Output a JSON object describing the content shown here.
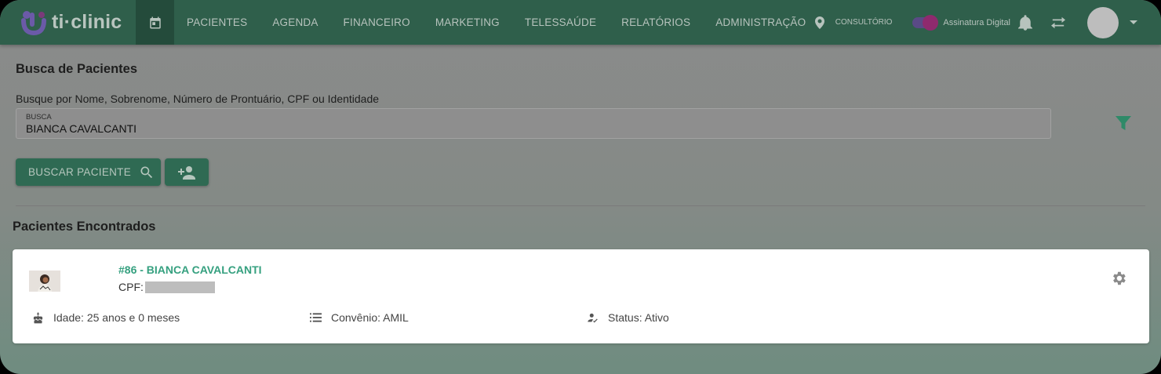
{
  "app": {
    "logo_text": "ti·clinic"
  },
  "nav": {
    "items": [
      "PACIENTES",
      "AGENDA",
      "FINANCEIRO",
      "MARKETING",
      "TELESSAÚDE",
      "RELATÓRIOS",
      "ADMINISTRAÇÃO"
    ],
    "location_label": "CONSULTÓRIO",
    "signature_label": "Assinatura Digital",
    "signature_enabled": true
  },
  "search": {
    "title": "Busca de Pacientes",
    "hint": "Busque por Nome, Sobrenome, Número de Prontuário, CPF ou Identidade",
    "field_label": "BUSCA",
    "field_value": "BIANCA CAVALCANTI",
    "search_button_label": "BUSCAR PACIENTE"
  },
  "results": {
    "title": "Pacientes Encontrados",
    "patients": [
      {
        "name": "#86 - BIANCA CAVALCANTI",
        "cpf_label": "CPF:",
        "age": "Idade: 25 anos e 0 meses",
        "insurance": "Convênio: AMIL",
        "status": "Status: Ativo"
      }
    ]
  },
  "colors": {
    "primary": "#2f5f4b",
    "accent": "#35a07f",
    "button": "#2f6a53"
  },
  "icons": {
    "calendar": "calendar-icon",
    "location": "location-pin-icon",
    "bell": "bell-icon",
    "swap": "swap-arrows-icon",
    "filter": "filter-icon",
    "search": "search-icon",
    "add_user": "add-person-icon",
    "gear": "gear-icon",
    "cake": "cake-icon",
    "list": "list-icon",
    "status": "person-check-icon"
  }
}
